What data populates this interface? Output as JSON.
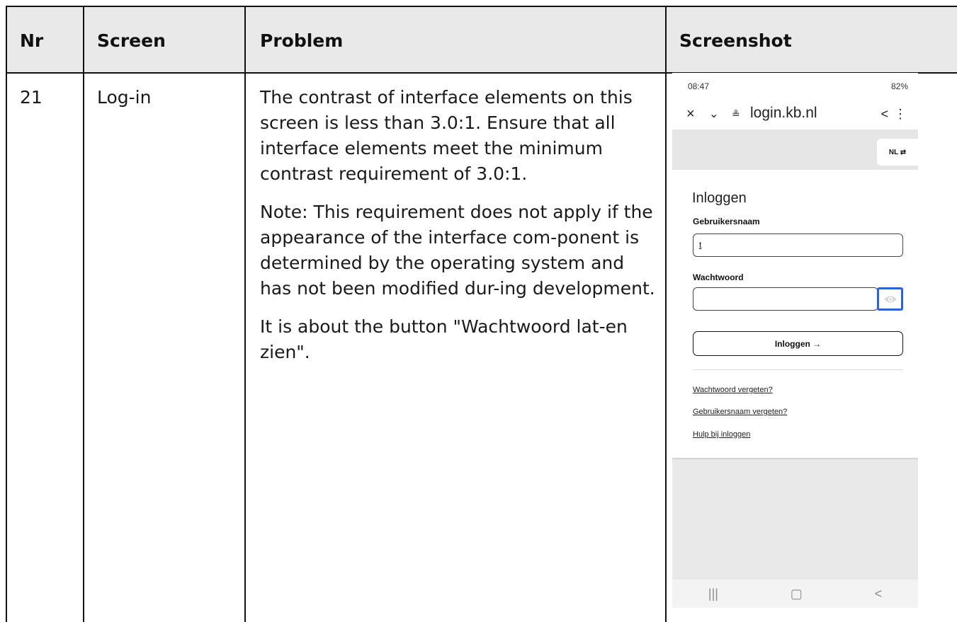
{
  "headers": {
    "nr": "Nr",
    "screen": "Screen",
    "problem": "Problem",
    "screenshot": "Screenshot"
  },
  "row": {
    "nr": "21",
    "screen": "Log-in",
    "problem": [
      "The contrast of interface elements on this screen is less than 3.0:1. Ensure that all interface elements meet the minimum contrast requirement of 3.0:1.",
      "Note: This requirement does not apply if the appearance of the interface com-ponent is determined by the operating system and has not been modified dur-ing development.",
      "It is about the button \"Wachtwoord lat-en zien\"."
    ]
  },
  "phone": {
    "status_time": "08:47",
    "status_right": "82%",
    "url": "login.kb.nl",
    "lang_button": "NL ⇄",
    "title": "Inloggen",
    "username_label": "Gebruikersnaam",
    "username_value": "t",
    "password_label": "Wachtwoord",
    "password_value": "",
    "login_button": "Inloggen →",
    "links": [
      "Wachtwoord vergeten?",
      "Gebruikersnaam vergeten?",
      "Hulp bij inloggen"
    ],
    "highlight_color": "#2c63d6"
  }
}
